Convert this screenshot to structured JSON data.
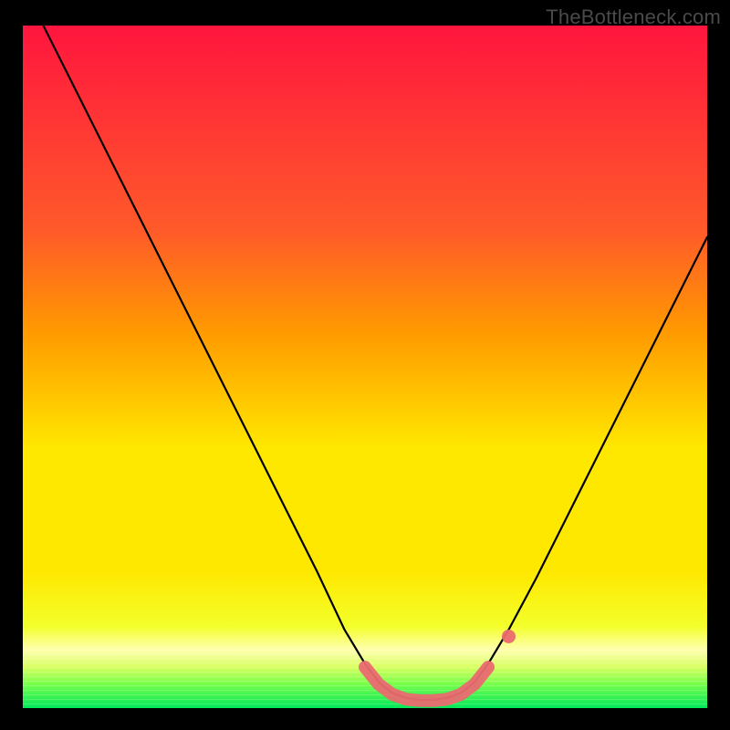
{
  "attribution": "TheBottleneck.com",
  "chart_data": {
    "type": "line",
    "title": "",
    "xlabel": "",
    "ylabel": "",
    "xlim": [
      0,
      100
    ],
    "ylim": [
      0,
      100
    ],
    "gradient_colors": {
      "top": "#ff153e",
      "mid1": "#ff9a00",
      "mid2": "#ffe800",
      "mid3": "#f3ff2a",
      "band": "#ffffb0",
      "bottom": "#00e85a"
    },
    "series": [
      {
        "name": "curve",
        "color": "#000000",
        "points": [
          {
            "x": 3.0,
            "y": 100.0
          },
          {
            "x": 8.0,
            "y": 90.0
          },
          {
            "x": 13.0,
            "y": 80.0
          },
          {
            "x": 18.0,
            "y": 70.0
          },
          {
            "x": 23.0,
            "y": 60.0
          },
          {
            "x": 28.0,
            "y": 50.0
          },
          {
            "x": 33.0,
            "y": 40.0
          },
          {
            "x": 38.0,
            "y": 30.0
          },
          {
            "x": 43.0,
            "y": 20.0
          },
          {
            "x": 47.0,
            "y": 11.5
          },
          {
            "x": 50.0,
            "y": 6.5
          },
          {
            "x": 52.0,
            "y": 3.8
          },
          {
            "x": 54.0,
            "y": 2.2
          },
          {
            "x": 56.0,
            "y": 1.5
          },
          {
            "x": 58.0,
            "y": 1.2
          },
          {
            "x": 60.0,
            "y": 1.2
          },
          {
            "x": 62.0,
            "y": 1.5
          },
          {
            "x": 64.0,
            "y": 2.2
          },
          {
            "x": 66.0,
            "y": 3.8
          },
          {
            "x": 68.0,
            "y": 6.5
          },
          {
            "x": 71.0,
            "y": 11.5
          },
          {
            "x": 75.0,
            "y": 19.0
          },
          {
            "x": 80.0,
            "y": 29.0
          },
          {
            "x": 85.0,
            "y": 39.0
          },
          {
            "x": 90.0,
            "y": 49.0
          },
          {
            "x": 95.0,
            "y": 59.0
          },
          {
            "x": 100.0,
            "y": 69.0
          }
        ]
      },
      {
        "name": "marker-zone",
        "color": "#ea6a70",
        "points": [
          {
            "x": 50.0,
            "y": 6.0
          },
          {
            "x": 52.0,
            "y": 3.5
          },
          {
            "x": 54.0,
            "y": 2.0
          },
          {
            "x": 56.0,
            "y": 1.3
          },
          {
            "x": 58.0,
            "y": 1.1
          },
          {
            "x": 60.0,
            "y": 1.1
          },
          {
            "x": 62.0,
            "y": 1.3
          },
          {
            "x": 64.0,
            "y": 2.0
          },
          {
            "x": 66.0,
            "y": 3.5
          },
          {
            "x": 68.0,
            "y": 6.0
          }
        ]
      },
      {
        "name": "marker-end",
        "color": "#ea6a70",
        "points": [
          {
            "x": 71.0,
            "y": 10.5
          }
        ]
      }
    ]
  }
}
